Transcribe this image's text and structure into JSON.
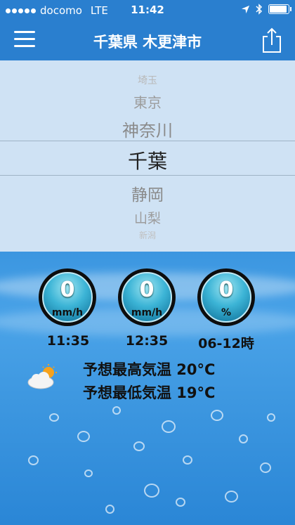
{
  "status_bar": {
    "carrier": "docomo",
    "network": "LTE",
    "time": "11:42"
  },
  "nav": {
    "title": "千葉県 木更津市"
  },
  "picker": {
    "items": [
      "埼玉",
      "東京",
      "神奈川",
      "千葉",
      "静岡",
      "山梨",
      "新潟"
    ],
    "selected": "千葉"
  },
  "gauges": [
    {
      "value": "0",
      "unit": "mm/h",
      "label": "11:35"
    },
    {
      "value": "0",
      "unit": "mm/h",
      "label": "12:35"
    },
    {
      "value": "0",
      "unit": "%",
      "label": "06-12時"
    }
  ],
  "forecast": {
    "high": "予想最高気温 20°C",
    "low": "予想最低気温 19°C"
  },
  "colors": {
    "nav_bg": "#2a7fcf",
    "picker_bg": "#cfe2f4",
    "gauge_fill": "#3cb4d6"
  },
  "icons": [
    "menu-icon",
    "share-icon",
    "location-icon",
    "bluetooth-icon",
    "battery-icon",
    "partly-cloudy-icon"
  ]
}
